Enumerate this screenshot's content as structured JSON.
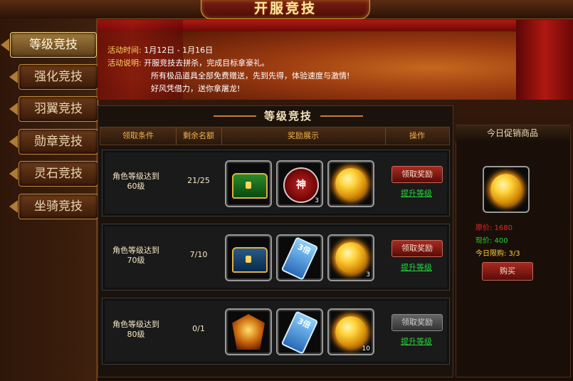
{
  "title": "开服竞技",
  "sidebar": {
    "items": [
      {
        "label": "等级竞技",
        "active": true
      },
      {
        "label": "强化竞技"
      },
      {
        "label": "羽翼竞技"
      },
      {
        "label": "勋章竞技"
      },
      {
        "label": "灵石竞技"
      },
      {
        "label": "坐骑竞技"
      }
    ]
  },
  "banner": {
    "time_label": "活动时间:",
    "time_value": "1月12日 - 1月16日",
    "desc_label": "活动说明:",
    "desc_line1": "开服竞技去拼杀，完成目标拿豪礼。",
    "desc_line2": "所有极品道具全部免费赠送，先到先得，体验速度与激情!",
    "desc_line3": "好风凭借力，送你拿屠龙!"
  },
  "section_title": "等级竞技",
  "table": {
    "headers": [
      "领取条件",
      "剩余名额",
      "奖励展示",
      "操作"
    ],
    "rows": [
      {
        "condition": "角色等级达到60级",
        "remaining": "21/25",
        "rewards": [
          {
            "icon": "chest-icon",
            "count": ""
          },
          {
            "icon": "divine-badge-icon",
            "text": "神",
            "count": "3"
          },
          {
            "icon": "golden-orb-icon",
            "count": ""
          }
        ],
        "claim_label": "领取奖励",
        "claim_enabled": true,
        "upgrade_label": "提升等级"
      },
      {
        "condition": "角色等级达到70级",
        "remaining": "7/10",
        "rewards": [
          {
            "icon": "chest-icon",
            "count": ""
          },
          {
            "icon": "triple-card-icon",
            "text": "3倍",
            "count": ""
          },
          {
            "icon": "golden-orb-icon",
            "count": "3"
          }
        ],
        "claim_label": "领取奖励",
        "claim_enabled": true,
        "upgrade_label": "提升等级"
      },
      {
        "condition": "角色等级达到80级",
        "remaining": "0/1",
        "rewards": [
          {
            "icon": "golden-armor-icon",
            "count": ""
          },
          {
            "icon": "triple-card-icon",
            "text": "3倍",
            "count": ""
          },
          {
            "icon": "golden-orb-icon",
            "count": "10"
          }
        ],
        "claim_label": "领取奖励",
        "claim_enabled": false,
        "upgrade_label": "提升等级"
      }
    ]
  },
  "shop": {
    "title": "今日促销商品",
    "item_icon": "golden-orb-icon",
    "original_price": "原价: 1680",
    "current_price": "现价: 400",
    "limit": "今日限购: 3/3",
    "buy_label": "购买",
    "colors": {
      "original": "#e02a2a",
      "current": "#25d23a",
      "limit": "#ffd23a"
    }
  }
}
